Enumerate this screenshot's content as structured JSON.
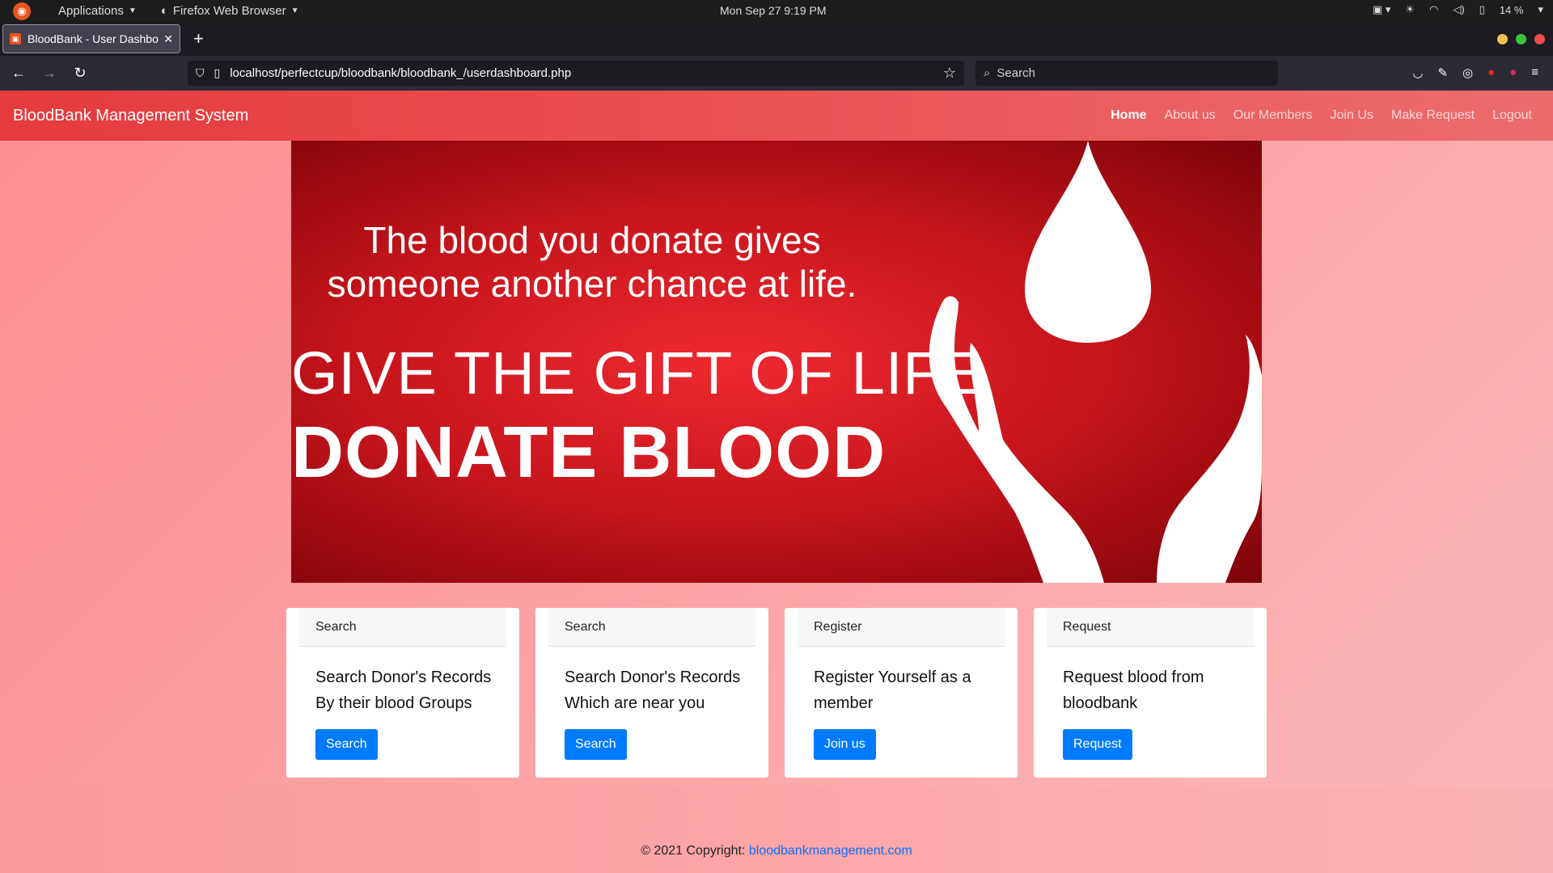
{
  "os_bar": {
    "applications": "Applications",
    "browser": "Firefox Web Browser",
    "clock": "Mon Sep 27   9:19 PM",
    "battery": "14 %"
  },
  "browser": {
    "tab_title": "BloodBank - User Dashbo",
    "url": "localhost/perfectcup/bloodbank/bloodbank_/userdashboard.php",
    "search_placeholder": "Search"
  },
  "site": {
    "brand": "BloodBank Management System",
    "nav": [
      {
        "label": "Home",
        "active": true
      },
      {
        "label": "About us",
        "active": false
      },
      {
        "label": "Our Members",
        "active": false
      },
      {
        "label": "Join Us",
        "active": false
      },
      {
        "label": "Make Request",
        "active": false
      },
      {
        "label": "Logout",
        "active": false
      }
    ],
    "hero": {
      "line1": "The blood you donate gives someone another chance at life.",
      "line2": "GIVE THE GIFT OF LIFE",
      "line3": "DONATE BLOOD"
    },
    "cards": [
      {
        "header": "Search",
        "text": "Search Donor's Records By their blood Groups",
        "button": "Search"
      },
      {
        "header": "Search",
        "text": "Search Donor's Records Which are near you",
        "button": "Search"
      },
      {
        "header": "Register",
        "text": "Register Yourself as a member",
        "button": "Join us"
      },
      {
        "header": "Request",
        "text": "Request blood from bloodbank",
        "button": "Request"
      }
    ],
    "footer": {
      "copyright": "© 2021 Copyright: ",
      "link": "bloodbankmanagement.com"
    }
  },
  "colors": {
    "nav_red": "#e63a3e",
    "button_blue": "#007bff",
    "hero_red": "#c5141c"
  }
}
